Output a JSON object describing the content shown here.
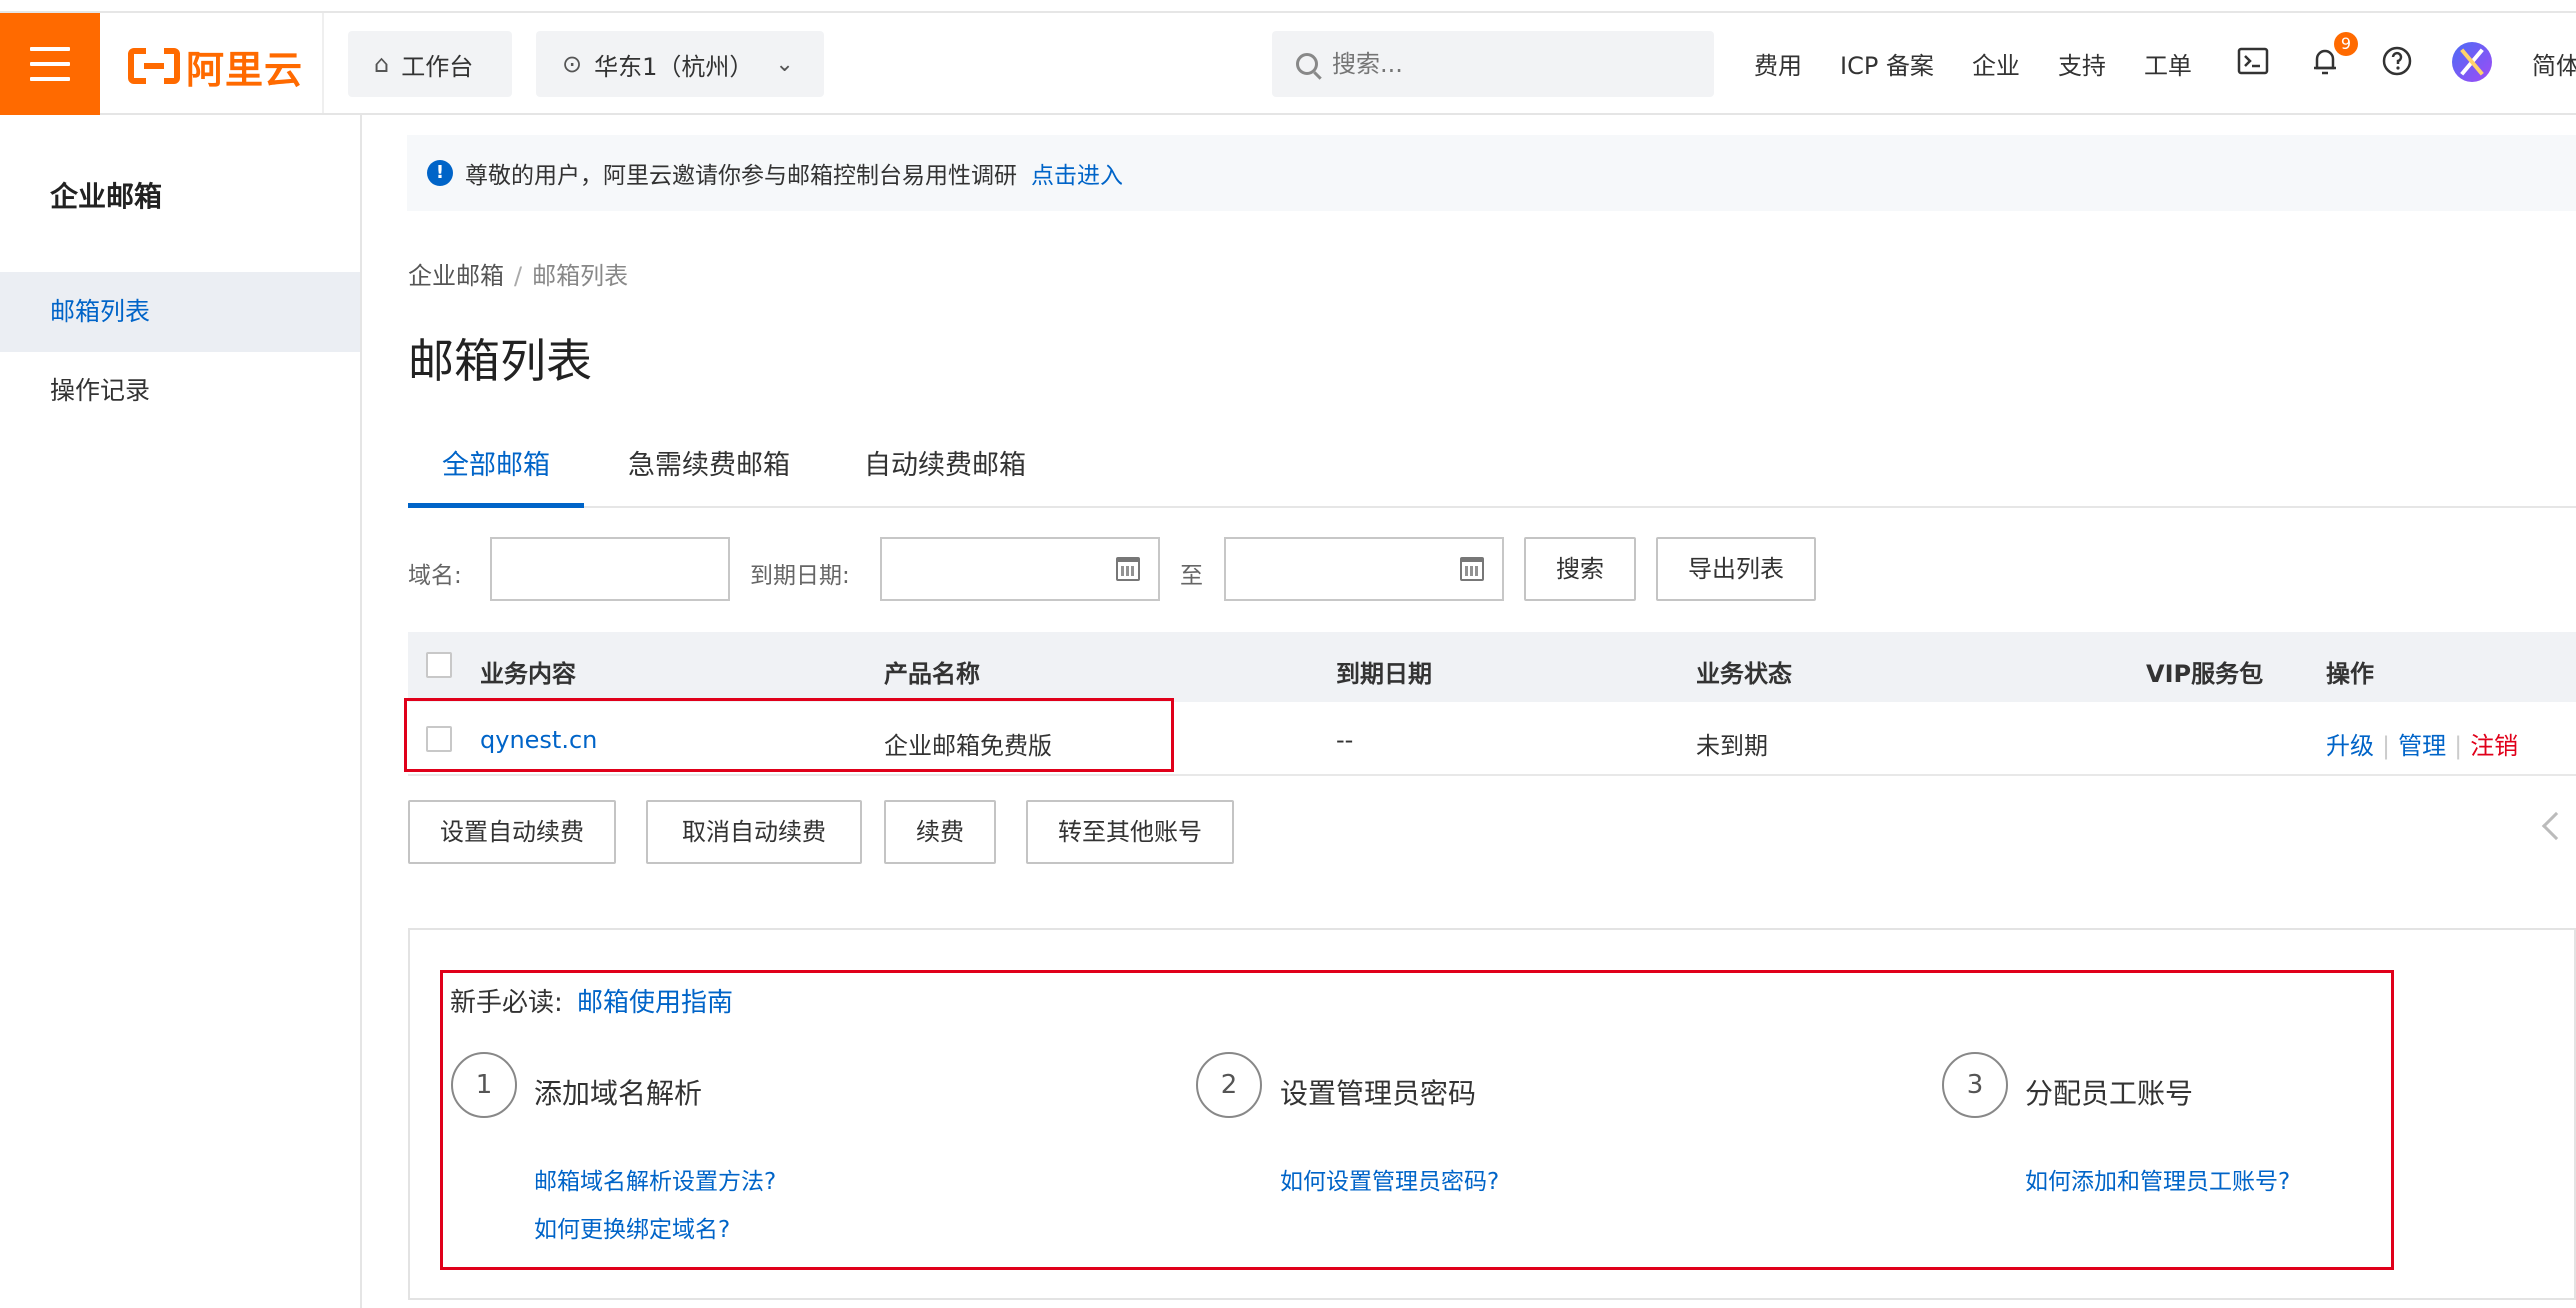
{
  "topbar": {
    "logo_text": "阿里云",
    "workbench": "工作台",
    "region": "华东1（杭州）",
    "search_placeholder": "搜索...",
    "links": [
      "费用",
      "ICP 备案",
      "企业",
      "支持",
      "工单"
    ],
    "notification_count": "9",
    "language": "简体"
  },
  "sidebar": {
    "title": "企业邮箱",
    "items": [
      {
        "label": "邮箱列表",
        "active": true
      },
      {
        "label": "操作记录",
        "active": false
      }
    ]
  },
  "notice": {
    "text": "尊敬的用户，阿里云邀请你参与邮箱控制台易用性调研",
    "link": "点击进入"
  },
  "breadcrumb": {
    "root": "企业邮箱",
    "separator": "/",
    "current": "邮箱列表"
  },
  "page_title": "邮箱列表",
  "tabs": [
    {
      "label": "全部邮箱",
      "active": true
    },
    {
      "label": "急需续费邮箱",
      "active": false
    },
    {
      "label": "自动续费邮箱",
      "active": false
    }
  ],
  "filters": {
    "domain_label": "域名:",
    "domain_value": "",
    "expiry_label": "到期日期:",
    "to_label": "至",
    "search_button": "搜索",
    "export_button": "导出列表"
  },
  "table": {
    "headers": [
      "业务内容",
      "产品名称",
      "到期日期",
      "业务状态",
      "VIP服务包",
      "操作"
    ],
    "rows": [
      {
        "content": "qynest.cn",
        "product": "企业邮箱免费版",
        "expiry": "--",
        "status": "未到期",
        "vip": "",
        "actions": [
          "升级",
          "管理",
          "注销"
        ]
      }
    ]
  },
  "bulk_actions": [
    "设置自动续费",
    "取消自动续费",
    "续费",
    "转至其他账号"
  ],
  "guide": {
    "prefix": "新手必读:",
    "title_link": "邮箱使用指南",
    "steps": [
      {
        "number": "1",
        "title": "添加域名解析",
        "links": [
          "邮箱域名解析设置方法?",
          "如何更换绑定域名?"
        ]
      },
      {
        "number": "2",
        "title": "设置管理员密码",
        "links": [
          "如何设置管理员密码?"
        ]
      },
      {
        "number": "3",
        "title": "分配员工账号",
        "links": [
          "如何添加和管理员工账号?"
        ]
      }
    ]
  },
  "colors": {
    "brand": "#ff6a00",
    "link": "#0064c8",
    "danger": "#e0001a",
    "highlight_box": "#e0001a"
  }
}
